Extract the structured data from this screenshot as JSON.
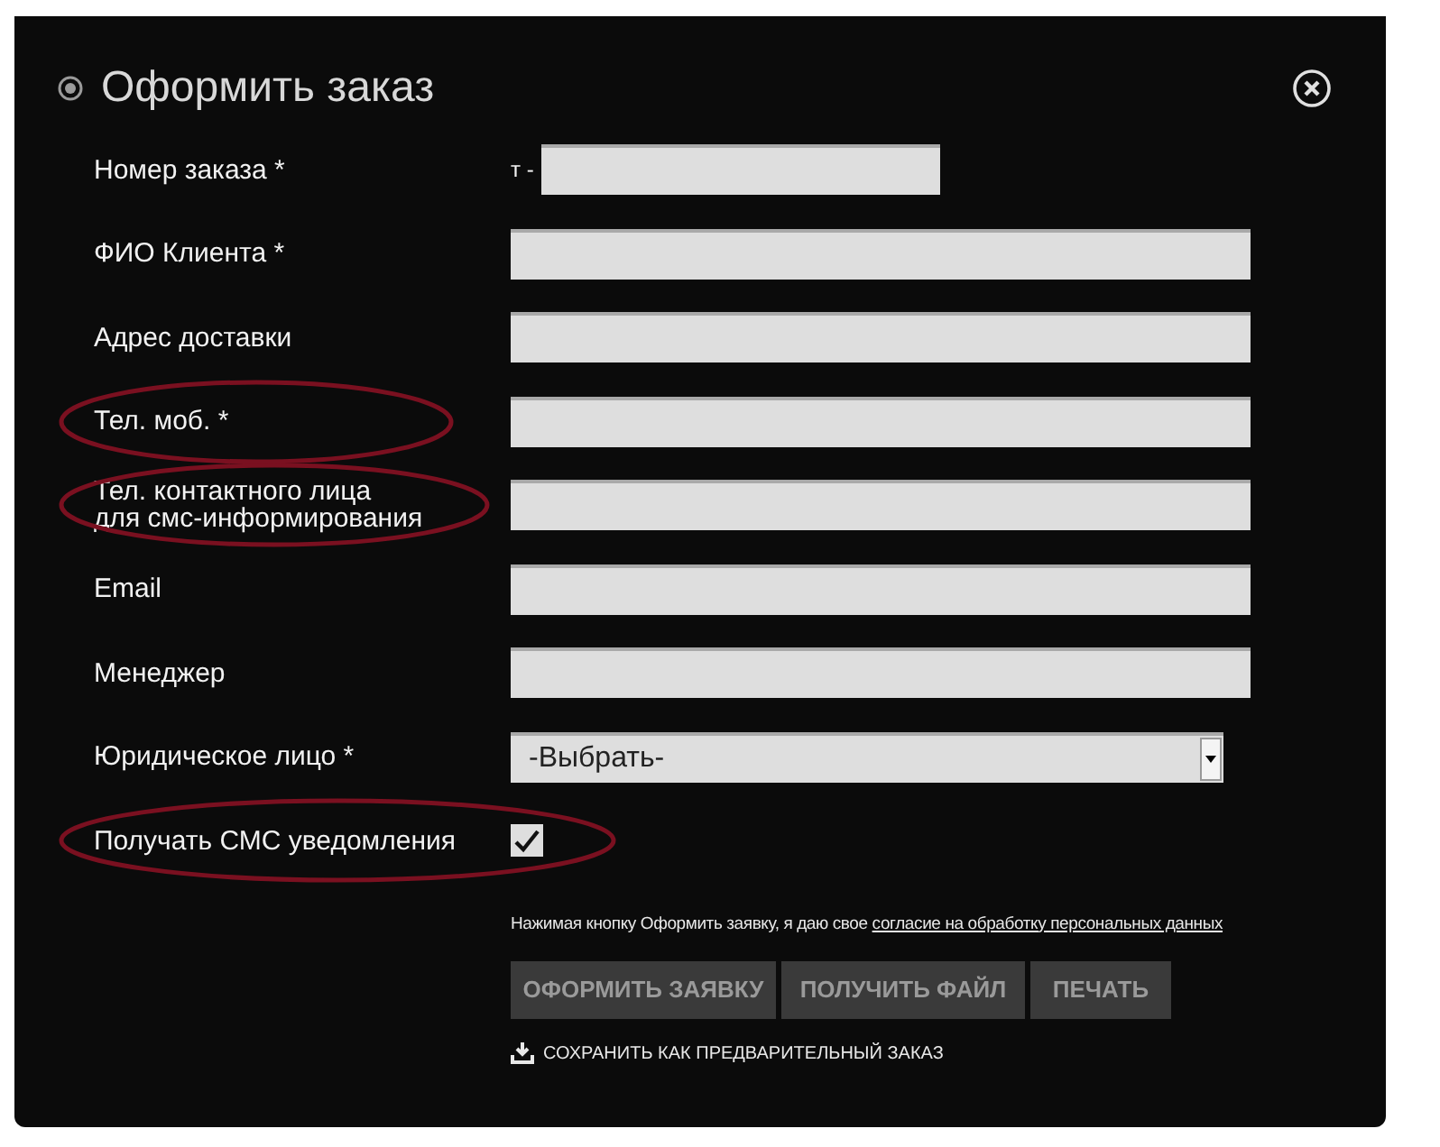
{
  "dialog": {
    "title": "Оформить заказ"
  },
  "rows": [
    {
      "kind": "text",
      "label": "Номер заказа *",
      "prefix": "т -",
      "highlighted": false
    },
    {
      "kind": "text",
      "label": "ФИО Клиента *",
      "highlighted": false
    },
    {
      "kind": "text",
      "label": "Адрес доставки",
      "highlighted": false
    },
    {
      "kind": "text",
      "label": "Тел. моб. *",
      "highlighted": true
    },
    {
      "kind": "text",
      "label": "Тел. контактного лица\nдля смс-информирования",
      "highlighted": true
    },
    {
      "kind": "text",
      "label": "Email",
      "highlighted": false
    },
    {
      "kind": "text",
      "label": "Менеджер",
      "highlighted": false
    },
    {
      "kind": "select",
      "label": "Юридическое лицо *",
      "value": "-Выбрать-",
      "highlighted": false
    },
    {
      "kind": "checkbox",
      "label": "Получать СМС уведомления",
      "checked": true,
      "highlighted": true
    }
  ],
  "consent": {
    "text": "Нажимая кнопку Оформить заявку, я даю свое",
    "link": "согласие на обработку персональных данных"
  },
  "buttons": [
    "ОФОРМИТЬ ЗАЯВКУ",
    "ПОЛУЧИТЬ ФАЙЛ",
    "ПЕЧАТЬ"
  ],
  "save_link": "СОХРАНИТЬ КАК ПРЕДВАРИТЕЛЬНЫЙ ЗАКАЗ"
}
